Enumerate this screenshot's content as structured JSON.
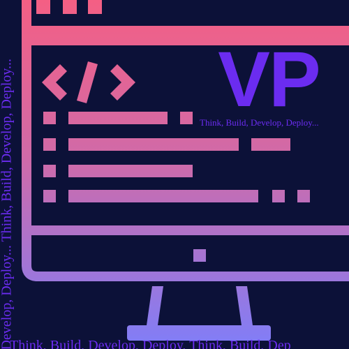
{
  "logo": {
    "monogram": "VP",
    "tagline": "Think, Build, Develop, Deploy..."
  },
  "side_text": "Develop, Deploy... Think, Build, Develop, Deploy...",
  "bottom_text": "Think, Build, Develop, Deploy, Think, Build, Dep",
  "icons": {
    "monitor": "monitor-icon",
    "code": "code-brackets-icon"
  },
  "colors": {
    "background": "#0c1138",
    "gradient_top": "#f45f84",
    "gradient_bottom": "#7f7ef9",
    "brand": "#6b2cf0"
  }
}
